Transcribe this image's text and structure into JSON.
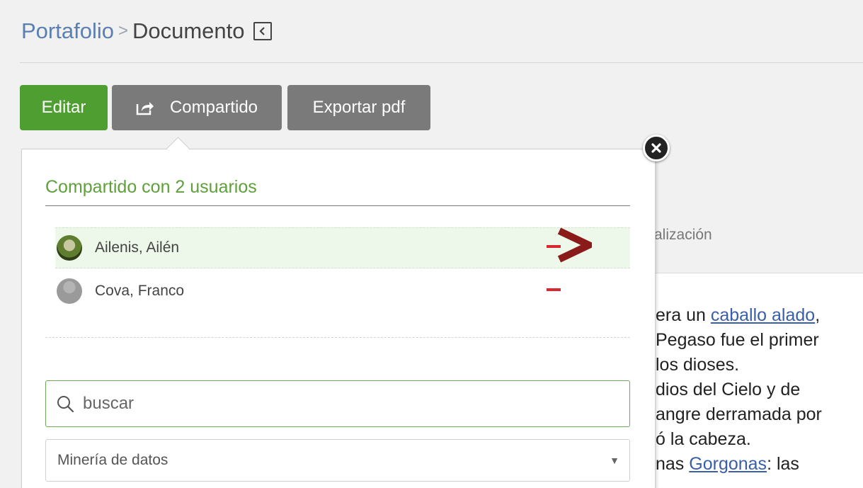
{
  "breadcrumb": {
    "root": "Portafolio",
    "separator": ">",
    "current": "Documento"
  },
  "toolbar": {
    "edit_label": "Editar",
    "share_label": "Compartido",
    "export_label": "Exportar pdf"
  },
  "share_popup": {
    "title": "Compartido con 2 usuarios",
    "users": [
      {
        "name": "Ailenis, Ailén",
        "highlighted": true
      },
      {
        "name": "Cova, Franco",
        "highlighted": false
      }
    ],
    "search_placeholder": "buscar",
    "selected_group": "Minería de datos"
  },
  "background": {
    "tab_label": "alización",
    "article_lines": [
      {
        "pre": "era un ",
        "link": "caballo alado",
        "post": ","
      },
      {
        "pre": "Pegaso fue el primer",
        "link": "",
        "post": ""
      },
      {
        "pre": "los dioses.",
        "link": "",
        "post": ""
      },
      {
        "pre": "dios del Cielo y de",
        "link": "",
        "post": ""
      },
      {
        "pre": "angre derramada por",
        "link": "",
        "post": ""
      },
      {
        "pre": "ó la cabeza.",
        "link": "",
        "post": ""
      },
      {
        "pre": "nas ",
        "link": "Gorgonas",
        "post": ": las"
      }
    ]
  },
  "colors": {
    "accent_green": "#4e9e32",
    "title_green": "#5ea03b",
    "remove_red": "#d9282f",
    "pointer_red": "#8b1a1a"
  }
}
